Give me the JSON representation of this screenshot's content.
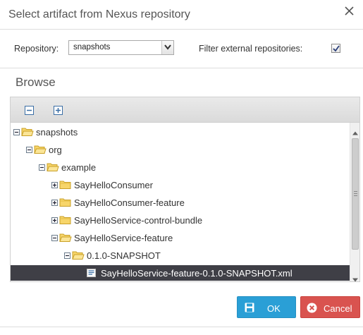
{
  "dialog": {
    "title": "Select artifact from Nexus repository",
    "close_icon": "close-icon"
  },
  "repository": {
    "label": "Repository:",
    "selected": "snapshots",
    "filter_label": "Filter external repositories:",
    "filter_checked": true
  },
  "browse": {
    "title": "Browse",
    "toolbar": [
      "collapse-all-icon",
      "expand-all-icon"
    ]
  },
  "tree": {
    "nodes": [
      {
        "label": "snapshots",
        "depth": 0,
        "state": "expanded"
      },
      {
        "label": "org",
        "depth": 1,
        "state": "expanded"
      },
      {
        "label": "example",
        "depth": 2,
        "state": "expanded"
      },
      {
        "label": "SayHelloConsumer",
        "depth": 3,
        "state": "collapsed"
      },
      {
        "label": "SayHelloConsumer-feature",
        "depth": 3,
        "state": "collapsed"
      },
      {
        "label": "SayHelloService-control-bundle",
        "depth": 3,
        "state": "collapsed"
      },
      {
        "label": "SayHelloService-feature",
        "depth": 3,
        "state": "expanded"
      },
      {
        "label": "0.1.0-SNAPSHOT",
        "depth": 4,
        "state": "expanded"
      },
      {
        "label": "SayHelloService-feature-0.1.0-SNAPSHOT.xml",
        "depth": 5,
        "state": "leaf",
        "selected": true
      }
    ]
  },
  "buttons": {
    "ok": "OK",
    "cancel": "Cancel"
  },
  "colors": {
    "ok": "#2a9fd6",
    "cancel": "#d9534f",
    "selection": "#3f3f46"
  }
}
